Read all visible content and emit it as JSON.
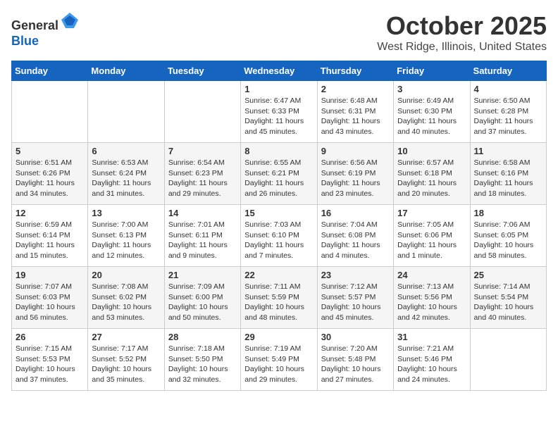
{
  "header": {
    "logo_line1": "General",
    "logo_line2": "Blue",
    "month": "October 2025",
    "location": "West Ridge, Illinois, United States"
  },
  "weekdays": [
    "Sunday",
    "Monday",
    "Tuesday",
    "Wednesday",
    "Thursday",
    "Friday",
    "Saturday"
  ],
  "weeks": [
    [
      {
        "day": "",
        "detail": ""
      },
      {
        "day": "",
        "detail": ""
      },
      {
        "day": "",
        "detail": ""
      },
      {
        "day": "1",
        "detail": "Sunrise: 6:47 AM\nSunset: 6:33 PM\nDaylight: 11 hours\nand 45 minutes."
      },
      {
        "day": "2",
        "detail": "Sunrise: 6:48 AM\nSunset: 6:31 PM\nDaylight: 11 hours\nand 43 minutes."
      },
      {
        "day": "3",
        "detail": "Sunrise: 6:49 AM\nSunset: 6:30 PM\nDaylight: 11 hours\nand 40 minutes."
      },
      {
        "day": "4",
        "detail": "Sunrise: 6:50 AM\nSunset: 6:28 PM\nDaylight: 11 hours\nand 37 minutes."
      }
    ],
    [
      {
        "day": "5",
        "detail": "Sunrise: 6:51 AM\nSunset: 6:26 PM\nDaylight: 11 hours\nand 34 minutes."
      },
      {
        "day": "6",
        "detail": "Sunrise: 6:53 AM\nSunset: 6:24 PM\nDaylight: 11 hours\nand 31 minutes."
      },
      {
        "day": "7",
        "detail": "Sunrise: 6:54 AM\nSunset: 6:23 PM\nDaylight: 11 hours\nand 29 minutes."
      },
      {
        "day": "8",
        "detail": "Sunrise: 6:55 AM\nSunset: 6:21 PM\nDaylight: 11 hours\nand 26 minutes."
      },
      {
        "day": "9",
        "detail": "Sunrise: 6:56 AM\nSunset: 6:19 PM\nDaylight: 11 hours\nand 23 minutes."
      },
      {
        "day": "10",
        "detail": "Sunrise: 6:57 AM\nSunset: 6:18 PM\nDaylight: 11 hours\nand 20 minutes."
      },
      {
        "day": "11",
        "detail": "Sunrise: 6:58 AM\nSunset: 6:16 PM\nDaylight: 11 hours\nand 18 minutes."
      }
    ],
    [
      {
        "day": "12",
        "detail": "Sunrise: 6:59 AM\nSunset: 6:14 PM\nDaylight: 11 hours\nand 15 minutes."
      },
      {
        "day": "13",
        "detail": "Sunrise: 7:00 AM\nSunset: 6:13 PM\nDaylight: 11 hours\nand 12 minutes."
      },
      {
        "day": "14",
        "detail": "Sunrise: 7:01 AM\nSunset: 6:11 PM\nDaylight: 11 hours\nand 9 minutes."
      },
      {
        "day": "15",
        "detail": "Sunrise: 7:03 AM\nSunset: 6:10 PM\nDaylight: 11 hours\nand 7 minutes."
      },
      {
        "day": "16",
        "detail": "Sunrise: 7:04 AM\nSunset: 6:08 PM\nDaylight: 11 hours\nand 4 minutes."
      },
      {
        "day": "17",
        "detail": "Sunrise: 7:05 AM\nSunset: 6:06 PM\nDaylight: 11 hours\nand 1 minute."
      },
      {
        "day": "18",
        "detail": "Sunrise: 7:06 AM\nSunset: 6:05 PM\nDaylight: 10 hours\nand 58 minutes."
      }
    ],
    [
      {
        "day": "19",
        "detail": "Sunrise: 7:07 AM\nSunset: 6:03 PM\nDaylight: 10 hours\nand 56 minutes."
      },
      {
        "day": "20",
        "detail": "Sunrise: 7:08 AM\nSunset: 6:02 PM\nDaylight: 10 hours\nand 53 minutes."
      },
      {
        "day": "21",
        "detail": "Sunrise: 7:09 AM\nSunset: 6:00 PM\nDaylight: 10 hours\nand 50 minutes."
      },
      {
        "day": "22",
        "detail": "Sunrise: 7:11 AM\nSunset: 5:59 PM\nDaylight: 10 hours\nand 48 minutes."
      },
      {
        "day": "23",
        "detail": "Sunrise: 7:12 AM\nSunset: 5:57 PM\nDaylight: 10 hours\nand 45 minutes."
      },
      {
        "day": "24",
        "detail": "Sunrise: 7:13 AM\nSunset: 5:56 PM\nDaylight: 10 hours\nand 42 minutes."
      },
      {
        "day": "25",
        "detail": "Sunrise: 7:14 AM\nSunset: 5:54 PM\nDaylight: 10 hours\nand 40 minutes."
      }
    ],
    [
      {
        "day": "26",
        "detail": "Sunrise: 7:15 AM\nSunset: 5:53 PM\nDaylight: 10 hours\nand 37 minutes."
      },
      {
        "day": "27",
        "detail": "Sunrise: 7:17 AM\nSunset: 5:52 PM\nDaylight: 10 hours\nand 35 minutes."
      },
      {
        "day": "28",
        "detail": "Sunrise: 7:18 AM\nSunset: 5:50 PM\nDaylight: 10 hours\nand 32 minutes."
      },
      {
        "day": "29",
        "detail": "Sunrise: 7:19 AM\nSunset: 5:49 PM\nDaylight: 10 hours\nand 29 minutes."
      },
      {
        "day": "30",
        "detail": "Sunrise: 7:20 AM\nSunset: 5:48 PM\nDaylight: 10 hours\nand 27 minutes."
      },
      {
        "day": "31",
        "detail": "Sunrise: 7:21 AM\nSunset: 5:46 PM\nDaylight: 10 hours\nand 24 minutes."
      },
      {
        "day": "",
        "detail": ""
      }
    ]
  ]
}
